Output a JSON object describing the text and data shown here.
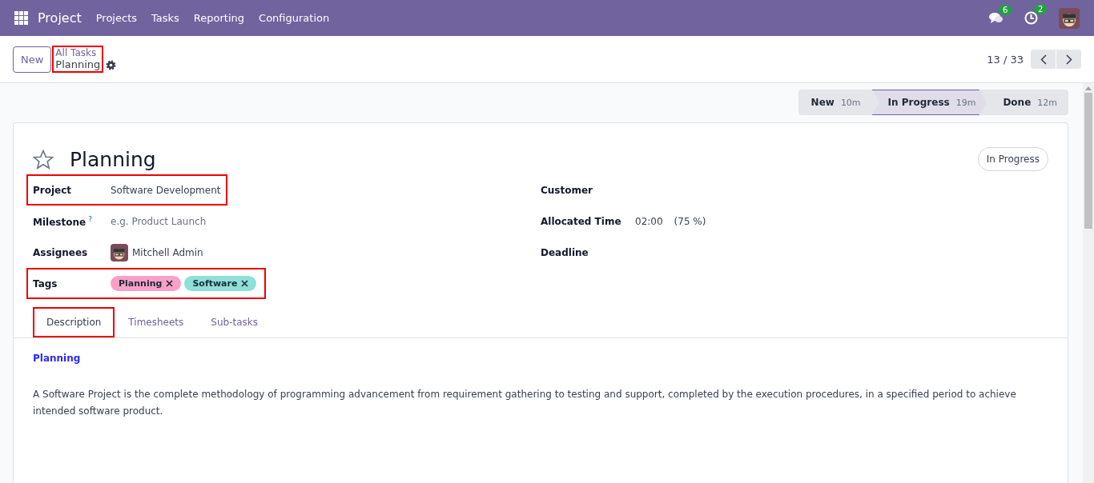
{
  "navbar": {
    "app": "Project",
    "menu": [
      "Projects",
      "Tasks",
      "Reporting",
      "Configuration"
    ],
    "messages_count": "6",
    "activities_count": "2"
  },
  "control_panel": {
    "new_button": "New",
    "breadcrumb": {
      "parent": "All Tasks",
      "current": "Planning",
      "highlighted": true
    },
    "pager": "13 / 33"
  },
  "stages": [
    {
      "name": "New",
      "duration": "10m",
      "selected": false
    },
    {
      "name": "In Progress",
      "duration": "19m",
      "selected": true
    },
    {
      "name": "Done",
      "duration": "12m",
      "selected": false
    }
  ],
  "task": {
    "title": "Planning",
    "starred": false,
    "status": "In Progress"
  },
  "left_fields": [
    {
      "kind": "text",
      "label": "Project",
      "value": "Software Development",
      "highlighted": true
    },
    {
      "kind": "placeholder",
      "label": "Milestone",
      "help": "?",
      "placeholder": "e.g. Product Launch",
      "highlighted": false
    },
    {
      "kind": "user",
      "label": "Assignees",
      "value": "Mitchell Admin",
      "highlighted": false
    },
    {
      "kind": "tags",
      "label": "Tags",
      "tags": [
        {
          "name": "Planning",
          "color": "#f7a1c9"
        },
        {
          "name": "Software",
          "color": "#8ee0d8"
        }
      ],
      "highlighted": true
    }
  ],
  "right_fields": [
    {
      "kind": "empty",
      "label": "Customer"
    },
    {
      "kind": "time",
      "label": "Allocated Time",
      "value": "02:00",
      "percent": "(75 %)"
    },
    {
      "kind": "empty",
      "label": "Deadline"
    }
  ],
  "tabs": [
    {
      "label": "Description",
      "selected": true,
      "highlighted": true
    },
    {
      "label": "Timesheets",
      "selected": false,
      "highlighted": false
    },
    {
      "label": "Sub-tasks",
      "selected": false,
      "highlighted": false
    }
  ],
  "description": {
    "heading": "Planning",
    "body": "A Software Project is the complete methodology of programming advancement from requirement gathering to testing and support, completed by the execution procedures, in a specified period to achieve intended software product."
  }
}
